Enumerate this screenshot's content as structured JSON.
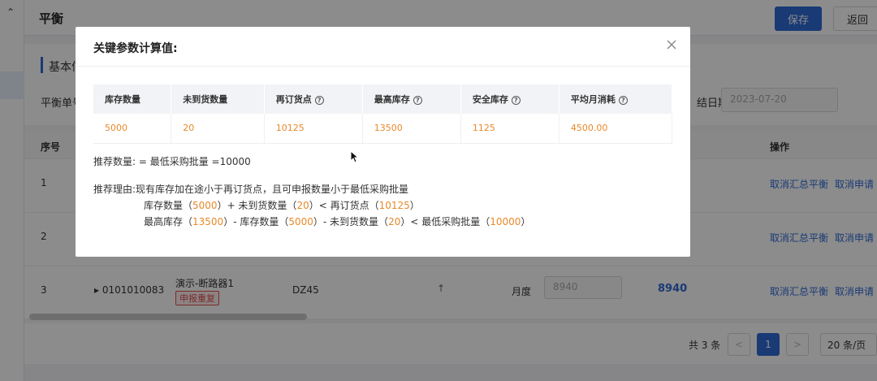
{
  "page": {
    "title": "平衡",
    "save_label": "保存",
    "back_label": "返回",
    "basic_section_title": "基本信",
    "field_label": "平衡单号",
    "date_label": "结日期",
    "date_value": "2023-07-20"
  },
  "table": {
    "col_no": "序号",
    "col_op": "操作",
    "rows": [
      {
        "no": "1",
        "op1": "取消汇总平衡",
        "op2": "取消申请"
      },
      {
        "no": "2",
        "op1": "取消汇总平衡",
        "op2": "取消申请"
      },
      {
        "no": "3",
        "code": "▸ 0101010083",
        "name": "演示-断路器1",
        "tag": "申报重复",
        "model": "DZ45",
        "arrow": "↑",
        "period": "月度",
        "qty_input": "8940",
        "qty_value": "8940",
        "op1": "取消汇总平衡",
        "op2": "取消申请"
      }
    ]
  },
  "pager": {
    "total": "共 3 条",
    "current": "1",
    "prev": "<",
    "next": ">",
    "size": "20 条/页"
  },
  "modal": {
    "title": "关键参数计算值:",
    "columns": [
      "库存数量",
      "未到货数量",
      "再订货点",
      "最高库存",
      "安全库存",
      "平均月消耗"
    ],
    "values": [
      "5000",
      "20",
      "10125",
      "13500",
      "1125",
      "4500.00"
    ],
    "rec_label": "推荐数量:",
    "rec_text": "= 最低采购批量 =10000",
    "reason_label": "推荐理由:",
    "reason_text": "现有库存加在途小于再订货点，且可申报数量小于最低采购批量",
    "l2_a": "库存数量（",
    "l2_v1": "5000",
    "l2_b": "）+ 未到货数量（",
    "l2_v2": "20",
    "l2_c": "）< 再订货点（",
    "l2_v3": "10125",
    "l2_d": "）",
    "l3_a": "最高库存（",
    "l3_v1": "13500",
    "l3_b": "）- 库存数量（",
    "l3_v2": "5000",
    "l3_c": "）- 未到货数量（",
    "l3_v3": "20",
    "l3_d": "）< 最低采购批量（",
    "l3_v4": "10000",
    "l3_e": "）"
  }
}
